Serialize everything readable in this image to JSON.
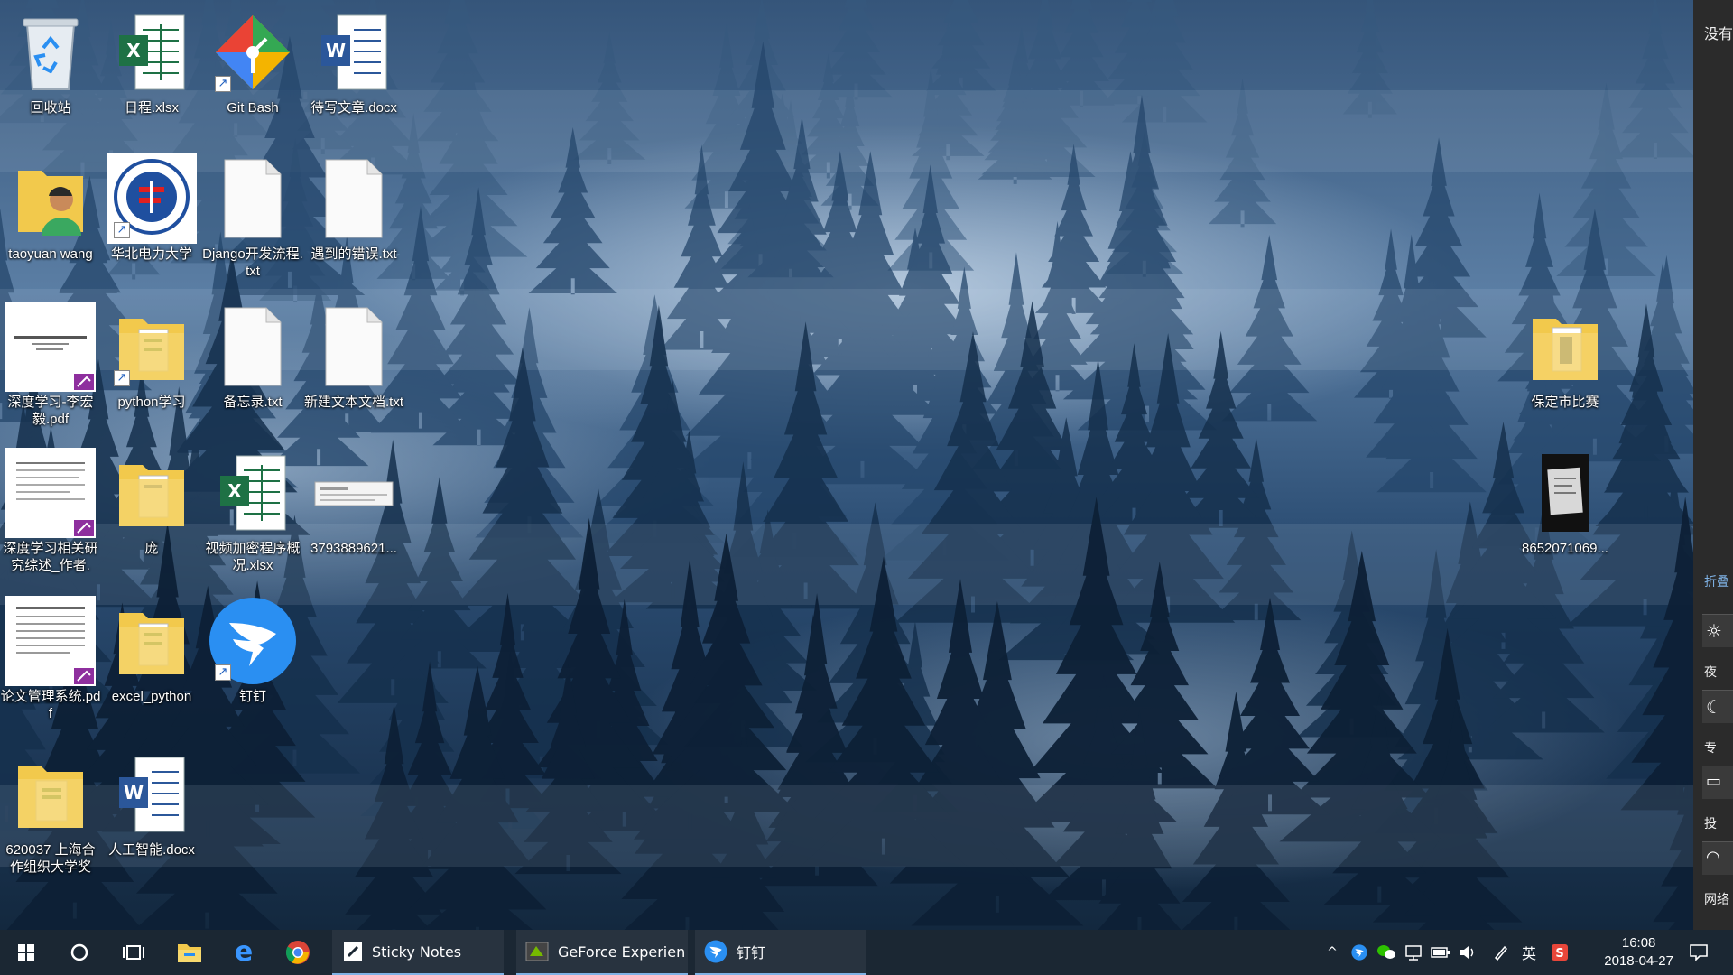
{
  "desktop": {
    "icons": [
      {
        "label": "回收站",
        "type": "recycle-bin",
        "shortcut": false
      },
      {
        "label": "日程.xlsx",
        "type": "excel",
        "shortcut": false
      },
      {
        "label": "Git Bash",
        "type": "git",
        "shortcut": true
      },
      {
        "label": "待写文章.docx",
        "type": "word",
        "shortcut": false
      },
      {
        "label": "taoyuan wang",
        "type": "user-folder",
        "shortcut": false
      },
      {
        "label": "华北电力大学",
        "type": "university-logo",
        "shortcut": true
      },
      {
        "label": "Django开发流程.txt",
        "type": "txt",
        "shortcut": false
      },
      {
        "label": "遇到的错误.txt",
        "type": "txt",
        "shortcut": false
      },
      {
        "label": "深度学习-李宏毅.pdf",
        "type": "pdf",
        "shortcut": false
      },
      {
        "label": "python学习",
        "type": "folder",
        "shortcut": true
      },
      {
        "label": "备忘录.txt",
        "type": "txt",
        "shortcut": false
      },
      {
        "label": "新建文本文档.txt",
        "type": "txt",
        "shortcut": false
      },
      {
        "label": "深度学习相关研究综述_作者.",
        "type": "pdf",
        "shortcut": false
      },
      {
        "label": "庞",
        "type": "folder",
        "shortcut": false
      },
      {
        "label": "视频加密程序概况.xlsx",
        "type": "excel",
        "shortcut": false
      },
      {
        "label": "3793889621...",
        "type": "image",
        "shortcut": false
      },
      {
        "label": "论文管理系统.pdf",
        "type": "pdf",
        "shortcut": false
      },
      {
        "label": "excel_python",
        "type": "folder",
        "shortcut": false
      },
      {
        "label": "钉钉",
        "type": "dingtalk",
        "shortcut": true
      },
      {
        "label": "620037 上海合作组织大学奖",
        "type": "folder",
        "shortcut": false
      },
      {
        "label": "人工智能.docx",
        "type": "word",
        "shortcut": false
      },
      {
        "label": "保定市比赛",
        "type": "folder",
        "shortcut": false
      },
      {
        "label": "8652071069...",
        "type": "photo",
        "shortcut": false
      }
    ]
  },
  "side_panel": {
    "top_text": "没有",
    "collapse_text": "折叠",
    "tiles": [
      "夜",
      "专",
      "投",
      "网络"
    ]
  },
  "taskbar": {
    "start_icon": "windows-logo-icon",
    "search_icon": "cortana-circle-icon",
    "apps": [
      {
        "label": "Sticky Notes",
        "icon": "sticky-notes-icon"
      },
      {
        "label": "GeForce Experien",
        "icon": "geforce-icon"
      },
      {
        "label": "钉钉",
        "icon": "dingtalk-icon"
      }
    ],
    "tray": {
      "ime": "英",
      "time": "16:08",
      "date": "2018-04-27"
    }
  },
  "colors": {
    "taskbar_bg": "#1b2733",
    "excel_green": "#1e7145",
    "word_blue": "#2b579a",
    "folder_yellow": "#f2c94c",
    "dingtalk_blue": "#2a8ff2"
  }
}
